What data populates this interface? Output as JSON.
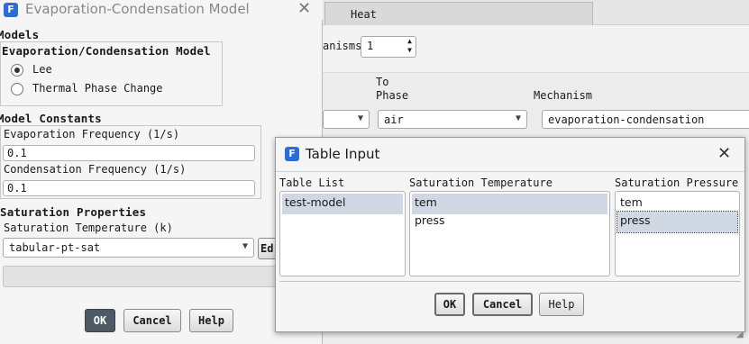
{
  "bg": {
    "tab_heat": "Heat",
    "mechanisms_label": "anisms",
    "mechanisms_value": "1",
    "to_phase_line1": "To",
    "to_phase_line2": "Phase",
    "mechanism_header": "Mechanism",
    "to_phase_value": "air",
    "mechanism_value": "evaporation-condensation"
  },
  "left_dialog": {
    "title": "Evaporation-Condensation Model",
    "models_label": "Models",
    "model_group_label": "Evaporation/Condensation Model",
    "options": [
      {
        "label": "Lee",
        "selected": true
      },
      {
        "label": "Thermal Phase Change",
        "selected": false
      }
    ],
    "constants_label": "Model Constants",
    "evap_label": "Evaporation Frequency (1/s)",
    "evap_value": "0.1",
    "cond_label": "Condensation Frequency (1/s)",
    "cond_value": "0.1",
    "sat_props_label": "Saturation Properties",
    "sat_temp_label": "Saturation Temperature (k)",
    "sat_temp_value": "tabular-pt-sat",
    "edit_button": "Ed",
    "ok": "OK",
    "cancel": "Cancel",
    "help": "Help"
  },
  "table_dialog": {
    "title": "Table Input",
    "table_list_header": "Table List",
    "table_list": [
      "test-model"
    ],
    "sat_temp_header": "Saturation Temperature",
    "sat_temp_items": [
      "tem",
      "press"
    ],
    "sat_press_header": "Saturation Pressure",
    "sat_press_items": [
      "tem",
      "press"
    ],
    "ok": "OK",
    "cancel": "Cancel",
    "help": "Help"
  },
  "colors": {
    "selection": "#cfd8e3",
    "primary_button": "#4d5a66",
    "app_icon": "#2d6bd6"
  }
}
